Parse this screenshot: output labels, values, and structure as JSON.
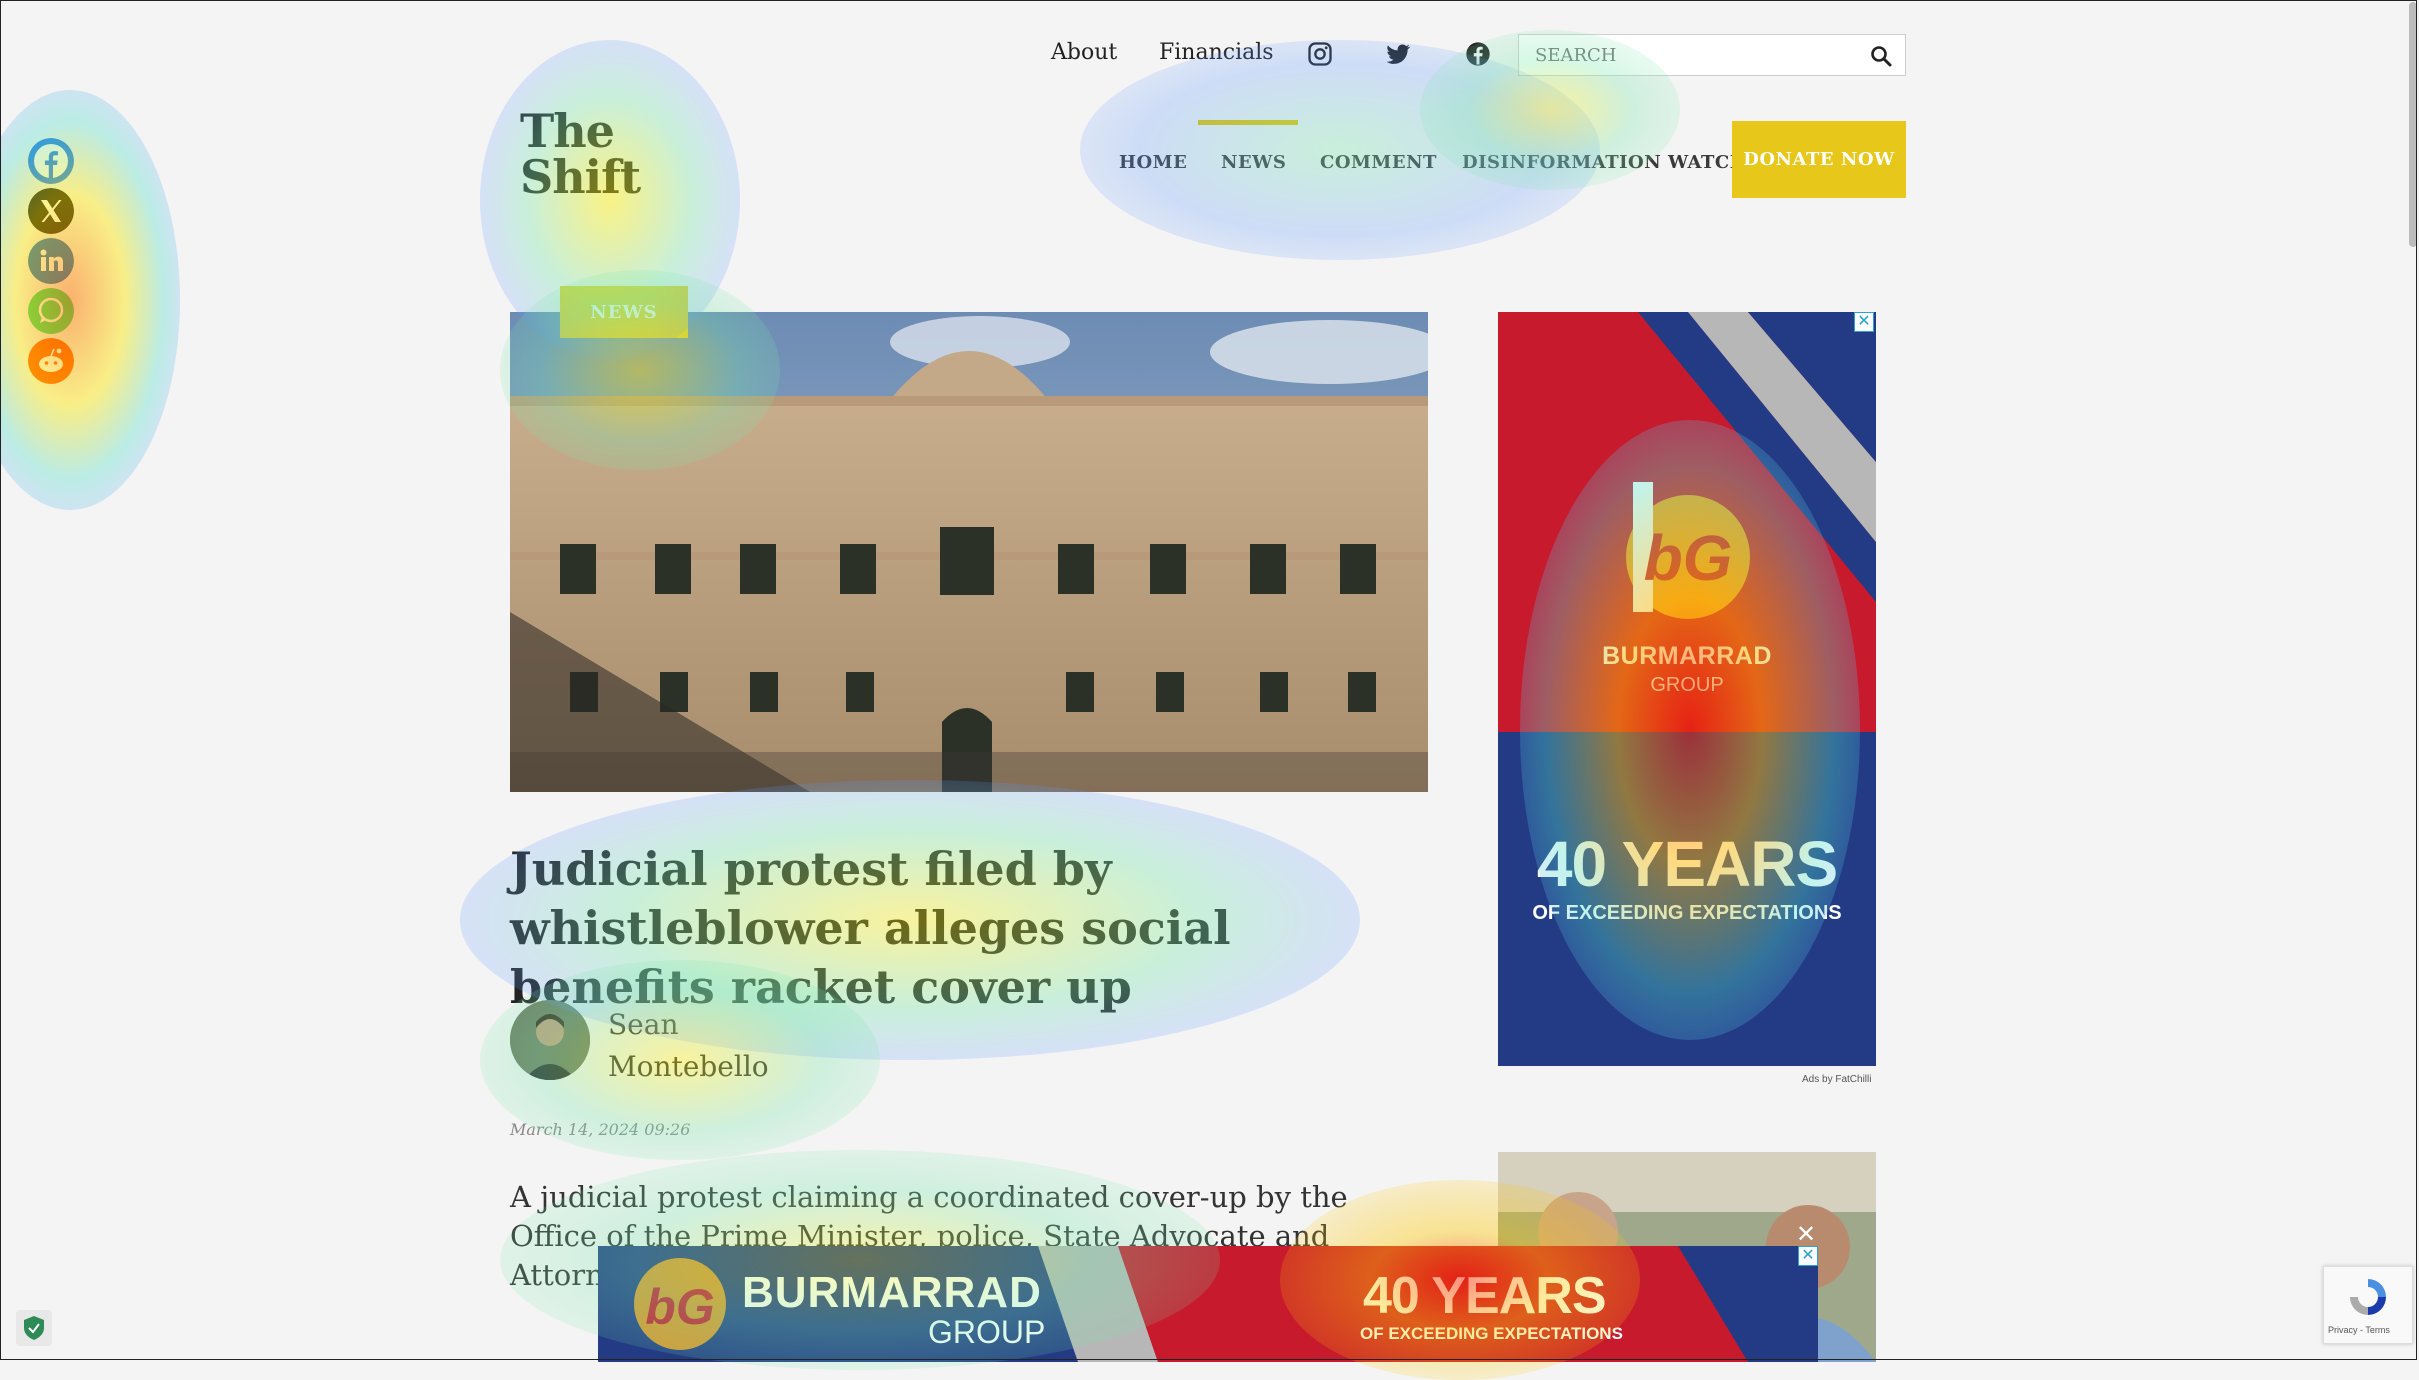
{
  "topbar": {
    "about": "About",
    "financials": "Financials",
    "icons": [
      "instagram-icon",
      "twitter-icon",
      "facebook-icon"
    ],
    "search_placeholder": "SEARCH"
  },
  "logo": {
    "line1": "The",
    "line2": "Shift"
  },
  "nav": {
    "items": [
      {
        "label": "HOME"
      },
      {
        "label": "NEWS",
        "active": true
      },
      {
        "label": "COMMENT"
      },
      {
        "label": "DISINFORMATION WATCH"
      }
    ],
    "donate": "DONATE NOW",
    "accent": "#e6c400"
  },
  "share": {
    "icons": [
      "facebook-icon",
      "x-icon",
      "linkedin-icon",
      "whatsapp-icon",
      "reddit-icon"
    ]
  },
  "article": {
    "category": "NEWS",
    "title": "Judicial protest filed by whistleblower alleges social benefits racket cover up",
    "author": "Sean Montebello",
    "date": "March 14, 2024 09:26",
    "lead": "A judicial protest claiming a coordinated cover-up by the Office of the Prime Minister, police, State Advocate and Attorney General of fraudu... was fil..."
  },
  "ad_side": {
    "brand": "BURMARRAD",
    "group": "GROUP",
    "years": "40 YEARS",
    "tagline": "OF EXCEEDING EXPECTATIONS",
    "attribution": "Ads by FatChilli"
  },
  "ad_banner": {
    "brand": "BURMARRAD",
    "group": "GROUP",
    "years": "40 YEARS",
    "tagline": "OF EXCEEDING EXPECTATIONS"
  },
  "recaptcha": {
    "text": "Privacy - Terms"
  }
}
